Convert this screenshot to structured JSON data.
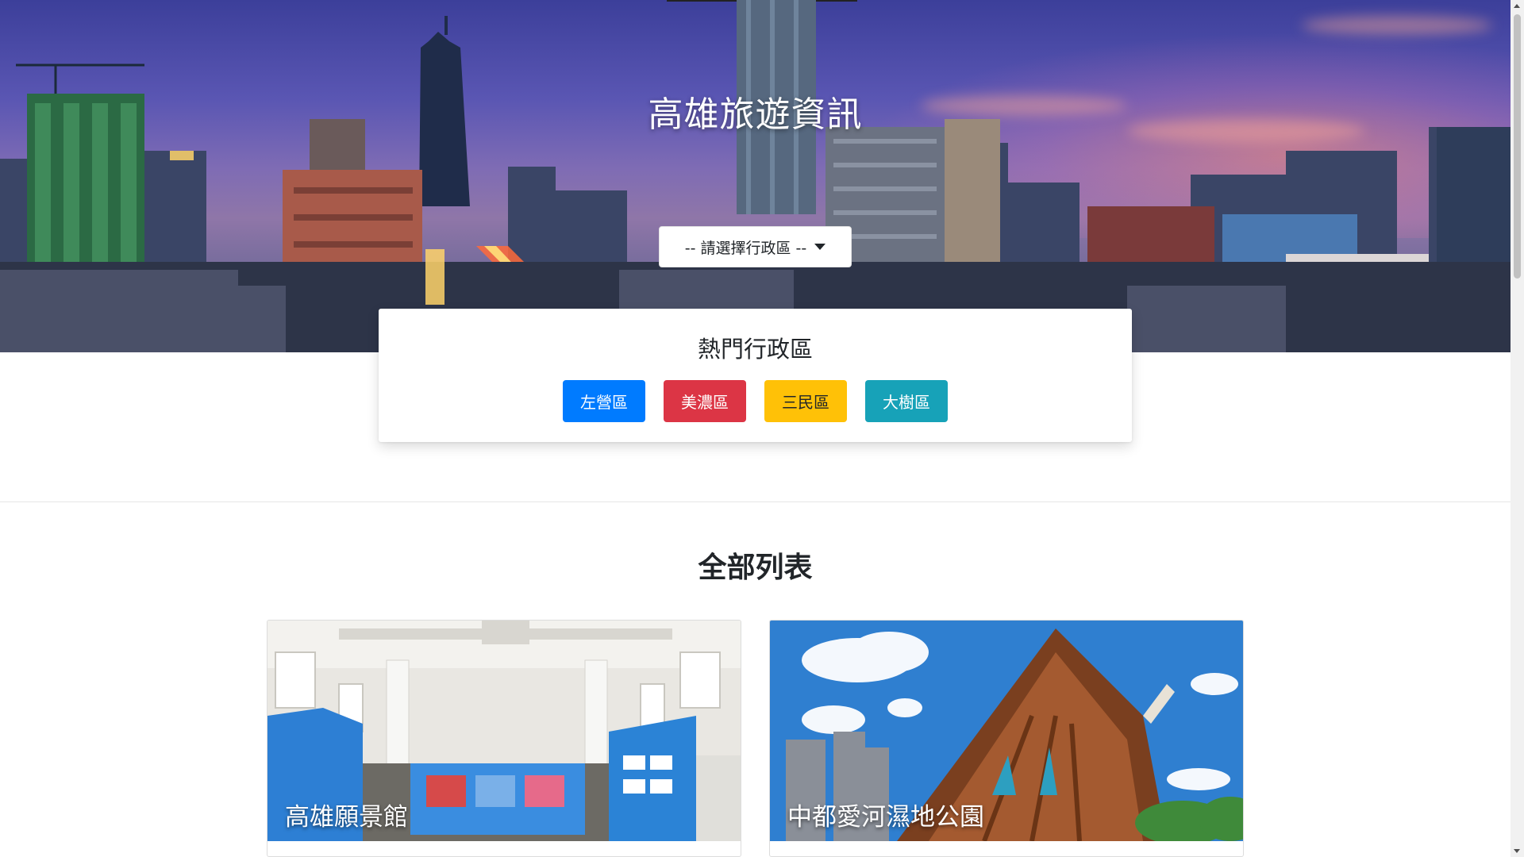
{
  "hero": {
    "title": "高雄旅遊資訊",
    "select_placeholder": "-- 請選擇行政區 --"
  },
  "popular": {
    "title": "熱門行政區",
    "districts": [
      {
        "label": "左營區",
        "color": "#007bff"
      },
      {
        "label": "美濃區",
        "color": "#dc3545"
      },
      {
        "label": "三民區",
        "color": "#ffc107",
        "text_color": "#212529"
      },
      {
        "label": "大樹區",
        "color": "#17a2b8"
      }
    ]
  },
  "list": {
    "title": "全部列表",
    "attractions": [
      {
        "name": "高雄願景館"
      },
      {
        "name": "中都愛河濕地公園"
      }
    ]
  }
}
